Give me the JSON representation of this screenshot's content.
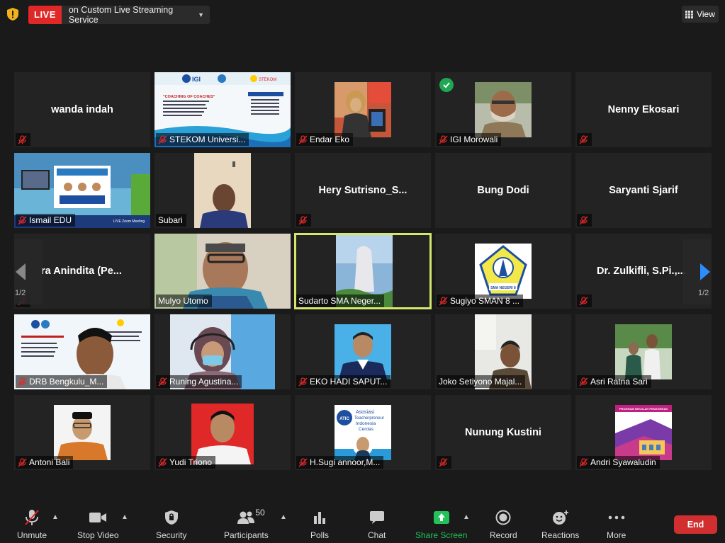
{
  "topbar": {
    "live_badge": "LIVE",
    "stream_label": "on Custom Live Streaming Service",
    "view_label": "View"
  },
  "pager": {
    "left": "1/2",
    "right": "1/2"
  },
  "tiles": [
    {
      "name": "wanda indah",
      "label": "",
      "mode": "name"
    },
    {
      "name": "",
      "label": "STEKOM Universi...",
      "mode": "video"
    },
    {
      "name": "",
      "label": "Endar Eko",
      "mode": "video"
    },
    {
      "name": "",
      "label": "IGI Morowali",
      "mode": "video"
    },
    {
      "name": "Nenny Ekosari",
      "label": "",
      "mode": "name"
    },
    {
      "name": "",
      "label": "Ismail EDU",
      "mode": "video"
    },
    {
      "name": "",
      "label": "Subari",
      "mode": "video"
    },
    {
      "name": "Hery  Sutrisno_S...",
      "label": "",
      "mode": "name"
    },
    {
      "name": "Bung Dodi",
      "label": "",
      "mode": "name"
    },
    {
      "name": "Saryanti Sjarif",
      "label": "",
      "mode": "name"
    },
    {
      "name": "ra Anindita  (Pe...",
      "label": "",
      "mode": "name"
    },
    {
      "name": "",
      "label": "Mulyo Utomo",
      "mode": "video"
    },
    {
      "name": "",
      "label": "Sudarto SMA Neger...",
      "mode": "video"
    },
    {
      "name": "",
      "label": "Sugiyo SMAN 8 ...",
      "mode": "video"
    },
    {
      "name": "Dr.  Zulkifli,  S.Pi.,...",
      "label": "",
      "mode": "name"
    },
    {
      "name": "",
      "label": "DRB Bengkulu_M...",
      "mode": "video"
    },
    {
      "name": "",
      "label": "Runing Agustina...",
      "mode": "video"
    },
    {
      "name": "",
      "label": "EKO HADI SAPUT...",
      "mode": "video"
    },
    {
      "name": "",
      "label": "Joko Setiyono Majal...",
      "mode": "video"
    },
    {
      "name": "",
      "label": "Asri Ratna Sari",
      "mode": "video"
    },
    {
      "name": "",
      "label": "Antoni Bali",
      "mode": "video"
    },
    {
      "name": "",
      "label": "Yudi Triono",
      "mode": "video"
    },
    {
      "name": "",
      "label": "H.Sugi annoor,M...",
      "mode": "video"
    },
    {
      "name": "Nunung Kustini",
      "label": "",
      "mode": "name"
    },
    {
      "name": "",
      "label": "Andri Syawaludin",
      "mode": "video"
    }
  ],
  "slide": {
    "title": "\"COACHING OF COACHES\"",
    "brand": "UNIVERSITAS STEKOM",
    "atic_line1": "Asosiasi",
    "atic_line2": "Teacherpreneur",
    "atic_line3": "Indonesia",
    "atic_line4": "Cerdas",
    "program": "PROGRAM SEKOLAH PENGGERAK",
    "school": "SMA NEGERI 8 SEMARANG"
  },
  "toolbar": {
    "unmute": "Unmute",
    "stop_video": "Stop Video",
    "security": "Security",
    "participants": "Participants",
    "participants_count": "50",
    "polls": "Polls",
    "chat": "Chat",
    "share_screen": "Share Screen",
    "record": "Record",
    "reactions": "Reactions",
    "more": "More",
    "end": "End"
  },
  "colors": {
    "live": "#e02828",
    "share": "#22c15a",
    "end": "#d12f2f",
    "active_border": "#d6e56c"
  }
}
